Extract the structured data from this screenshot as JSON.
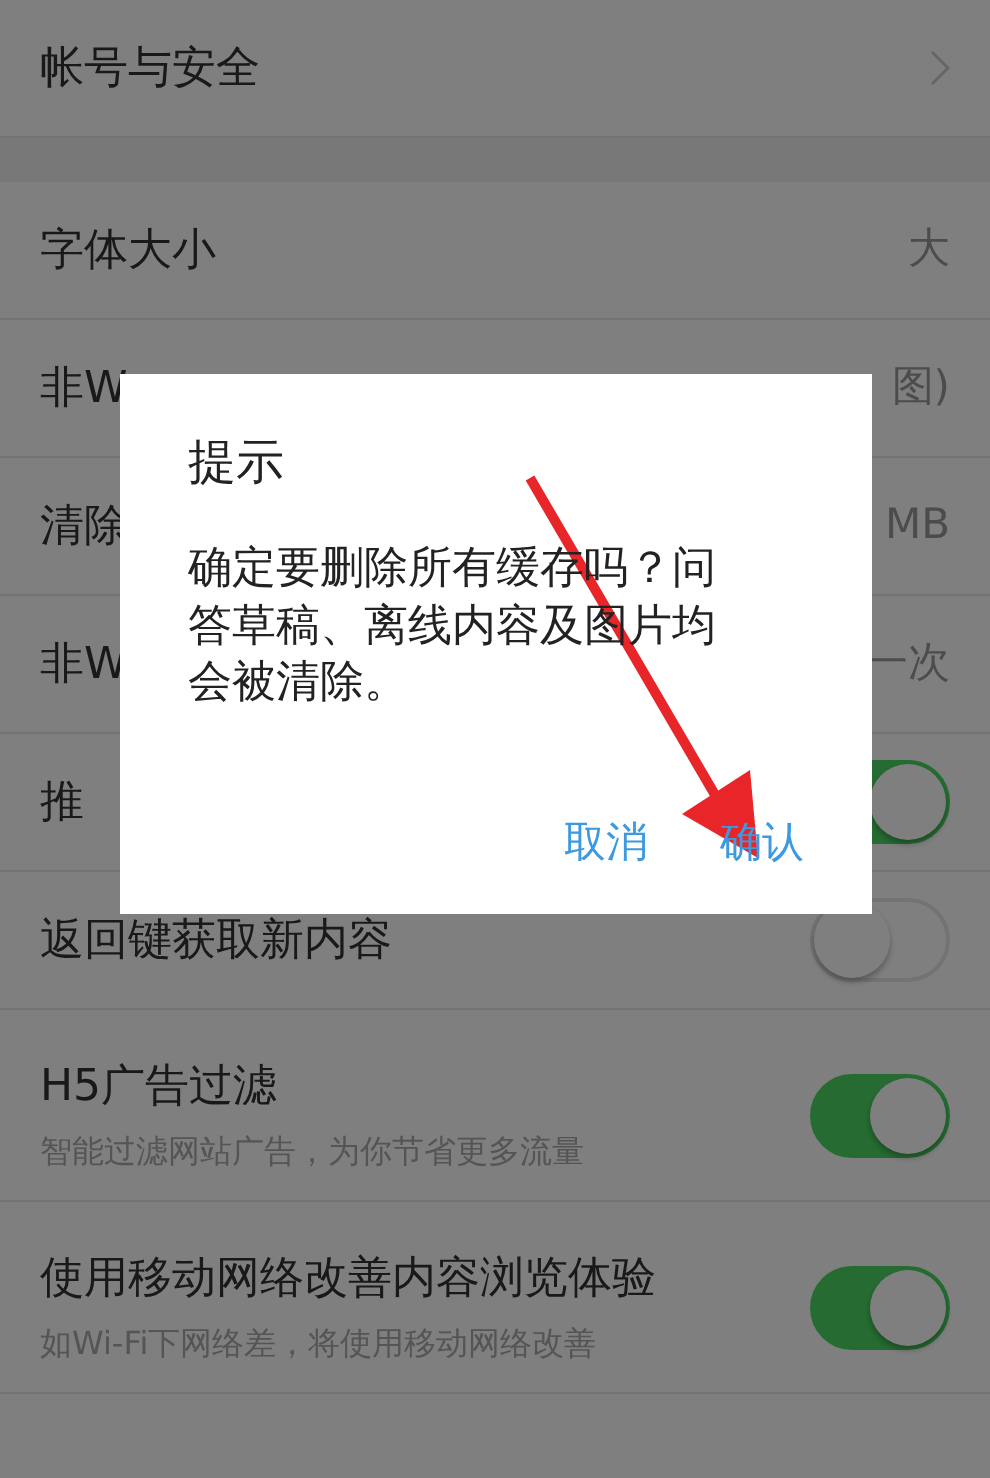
{
  "settings": [
    {
      "kind": "link",
      "label": "帐号与安全"
    },
    {
      "kind": "spacer"
    },
    {
      "kind": "value",
      "label": "字体大小",
      "value": "大"
    },
    {
      "kind": "value",
      "label": "非W",
      "value": "图)"
    },
    {
      "kind": "value",
      "label": "清除",
      "value": "MB"
    },
    {
      "kind": "value",
      "label": "非W",
      "value": "一次"
    },
    {
      "kind": "toggle",
      "label": "推",
      "on": true
    },
    {
      "kind": "toggle",
      "label": "返回键获取新内容",
      "on": false
    },
    {
      "kind": "toggle",
      "label": "H5广告过滤",
      "subtitle": "智能过滤网站广告，为你节省更多流量",
      "on": true
    },
    {
      "kind": "toggle",
      "label": "使用移动网络改善内容浏览体验",
      "subtitle": "如Wi-Fi下网络差，将使用移动网络改善",
      "on": true
    }
  ],
  "dialog": {
    "title": "提示",
    "message": "确定要删除所有缓存吗？问答草稿、离线内容及图片均会被清除。",
    "buttons": [
      "取消",
      "确认"
    ]
  }
}
